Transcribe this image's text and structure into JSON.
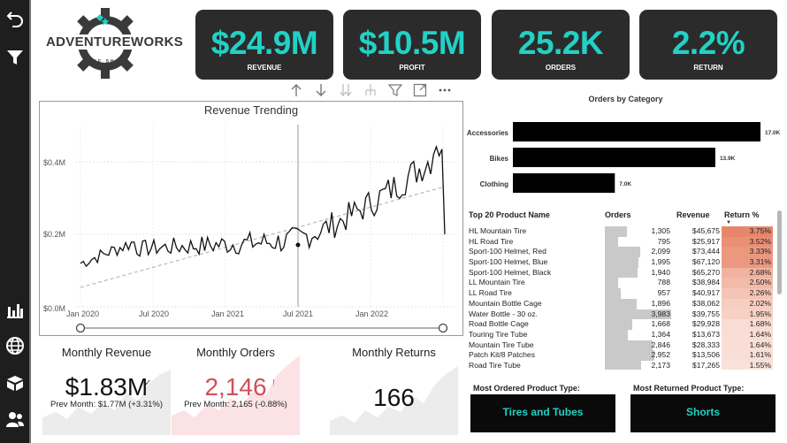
{
  "logo": {
    "text": "ADVENTUREWORKS",
    "small_text": "BIKE SHOP"
  },
  "kpis": [
    {
      "value": "$24.9M",
      "label": "REVENUE"
    },
    {
      "value": "$10.5M",
      "label": "PROFIT"
    },
    {
      "value": "25.2K",
      "label": "ORDERS"
    },
    {
      "value": "2.2%",
      "label": "RETURN"
    }
  ],
  "nav": {
    "top": [
      "back-icon",
      "filter-icon"
    ],
    "bottom": [
      "bar-chart-icon",
      "globe-icon",
      "box-icon",
      "users-icon"
    ]
  },
  "visual_header": [
    "arrow-up-icon",
    "arrow-down-icon",
    "double-arrow-down-icon",
    "expand-hierarchy-icon",
    "filter-icon",
    "focus-mode-icon",
    "more-options-icon"
  ],
  "trend": {
    "title": "Revenue Trending",
    "y_ticks": [
      "$0.0M",
      "$0.2M",
      "$0.4M"
    ],
    "x_ticks": [
      "Jan 2020",
      "Jul 2020",
      "Jan 2021",
      "Jul 2021",
      "Jan 2022"
    ]
  },
  "chart_data": {
    "type": "bar",
    "title": "Orders by Category",
    "orientation": "horizontal",
    "categories": [
      "Accessories",
      "Bikes",
      "Clothing"
    ],
    "values": [
      17000,
      13900,
      7000
    ],
    "data_labels": [
      "17.0K",
      "13.9K",
      "7.0K"
    ],
    "xlim": [
      0,
      17000
    ],
    "bar_color": "#000000"
  },
  "table": {
    "headers": [
      "Top 20 Product Name",
      "Orders",
      "Revenue",
      "Return %"
    ],
    "orders_max": 3983,
    "return_max": 3.75,
    "rows": [
      {
        "name": "HL Mountain Tire",
        "orders": 1305,
        "orders_label": "1,305",
        "revenue": "$45,675",
        "ret": 3.75,
        "ret_label": "3.75%"
      },
      {
        "name": "HL Road Tire",
        "orders": 795,
        "orders_label": "795",
        "revenue": "$25,917",
        "ret": 3.52,
        "ret_label": "3.52%"
      },
      {
        "name": "Sport-100 Helmet, Red",
        "orders": 2099,
        "orders_label": "2,099",
        "revenue": "$73,444",
        "ret": 3.33,
        "ret_label": "3.33%"
      },
      {
        "name": "Sport-100 Helmet, Blue",
        "orders": 1995,
        "orders_label": "1,995",
        "revenue": "$67,120",
        "ret": 3.31,
        "ret_label": "3.31%"
      },
      {
        "name": "Sport-100 Helmet, Black",
        "orders": 1940,
        "orders_label": "1,940",
        "revenue": "$65,270",
        "ret": 2.68,
        "ret_label": "2.68%"
      },
      {
        "name": "LL Mountain Tire",
        "orders": 788,
        "orders_label": "788",
        "revenue": "$38,984",
        "ret": 2.5,
        "ret_label": "2.50%"
      },
      {
        "name": "LL Road Tire",
        "orders": 957,
        "orders_label": "957",
        "revenue": "$40,917",
        "ret": 2.26,
        "ret_label": "2.26%"
      },
      {
        "name": "Mountain Bottle Cage",
        "orders": 1896,
        "orders_label": "1,896",
        "revenue": "$38,062",
        "ret": 2.02,
        "ret_label": "2.02%"
      },
      {
        "name": "Water Bottle - 30 oz.",
        "orders": 3983,
        "orders_label": "3,983",
        "revenue": "$39,755",
        "ret": 1.95,
        "ret_label": "1.95%"
      },
      {
        "name": "Road Bottle Cage",
        "orders": 1668,
        "orders_label": "1,668",
        "revenue": "$29,928",
        "ret": 1.68,
        "ret_label": "1.68%"
      },
      {
        "name": "Touring Tire Tube",
        "orders": 1364,
        "orders_label": "1,364",
        "revenue": "$13,673",
        "ret": 1.64,
        "ret_label": "1.64%"
      },
      {
        "name": "Mountain Tire Tube",
        "orders": 2846,
        "orders_label": "2,846",
        "revenue": "$28,333",
        "ret": 1.64,
        "ret_label": "1.64%"
      },
      {
        "name": "Patch Kit/8 Patches",
        "orders": 2952,
        "orders_label": "2,952",
        "revenue": "$13,506",
        "ret": 1.61,
        "ret_label": "1.61%"
      },
      {
        "name": "Road Tire Tube",
        "orders": 2173,
        "orders_label": "2,173",
        "revenue": "$17,265",
        "ret": 1.55,
        "ret_label": "1.55%"
      }
    ]
  },
  "monthly": [
    {
      "title": "Monthly Revenue",
      "value": "$1.83M",
      "sub": "Prev Month: $1.77M (+3.31%)",
      "color": "#111111",
      "spark_color": "#e8e8e8"
    },
    {
      "title": "Monthly Orders",
      "value": "2,146",
      "sub": "Prev Month: 2,165 (-0.88%)",
      "color": "#d0505c",
      "spark_color": "#fbe4e6"
    },
    {
      "title": "Monthly Returns",
      "value": "166",
      "sub": "",
      "color": "#111111",
      "spark_color": "#e8e8e8"
    }
  ],
  "product_types": [
    {
      "label": "Most Ordered Product Type:",
      "value": "Tires and Tubes"
    },
    {
      "label": "Most Returned Product Type:",
      "value": "Shorts"
    }
  ],
  "colors": {
    "accent": "#22d1c6",
    "card": "#2b2b2b",
    "return_high": "#e8866a",
    "return_low": "#fbe7e0"
  }
}
